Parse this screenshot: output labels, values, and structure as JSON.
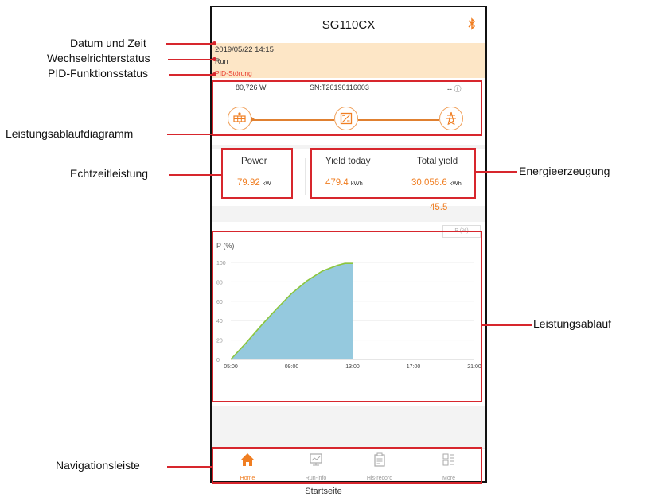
{
  "app": {
    "title": "SG110CX",
    "bluetooth_icon": "bluetooth-icon",
    "status": {
      "datetime": "2019/05/22 14:15",
      "run_state": "Run",
      "pid_state": "PID-Störung"
    },
    "flow": {
      "power": "80,726 W",
      "serial": "SN:T20190116003",
      "grid_value": "-- ⓘ",
      "icons": [
        "solar-panel-icon",
        "inverter-icon",
        "grid-tower-icon"
      ]
    },
    "kpi": {
      "power_label": "Power",
      "power_value": "79.92",
      "power_unit": "kW",
      "yield_today_label": "Yield today",
      "yield_today_value": "479.4",
      "yield_today_unit": "kWh",
      "total_yield_label": "Total yield",
      "total_yield_value": "30,056.6",
      "total_yield_unit": "kWh",
      "extra_value": "45.5"
    },
    "nav": [
      {
        "label": "Home",
        "icon": "home-icon",
        "active": true
      },
      {
        "label": "Run-info",
        "icon": "monitor-icon",
        "active": false
      },
      {
        "label": "His-record",
        "icon": "clipboard-icon",
        "active": false
      },
      {
        "label": "More",
        "icon": "menu-grid-icon",
        "active": false
      }
    ]
  },
  "chart_data": {
    "type": "area",
    "ylabel": "P (%)",
    "legend": "P (%)",
    "legend_position": "top-right",
    "x_ticks": [
      "05:00",
      "09:00",
      "13:00",
      "17:00",
      "21:00"
    ],
    "y_ticks": [
      "0",
      "20",
      "40",
      "60",
      "80",
      "100"
    ],
    "ylim": [
      0,
      100
    ],
    "series": [
      {
        "name": "P (%)",
        "x": [
          "05:00",
          "06:00",
          "07:00",
          "08:00",
          "09:00",
          "10:00",
          "11:00",
          "12:00",
          "12:30",
          "13:00"
        ],
        "values": [
          0,
          17,
          35,
          52,
          68,
          81,
          91,
          97,
          99,
          99
        ]
      }
    ],
    "colors": {
      "fill": "#95c9de",
      "line": "#8cc63f"
    },
    "grid": true
  },
  "annotations": {
    "datetime": "Datum und Zeit",
    "inverter_status": "Wechselrichterstatus",
    "pid_status": "PID-Funktionsstatus",
    "power_flow": "Leistungsablaufdiagramm",
    "realtime_power": "Echtzeitleistung",
    "energy_yield": "Energieerzeugung",
    "power_curve": "Leistungsablauf",
    "navigation": "Navigationsleiste",
    "caption": "Startseite"
  }
}
